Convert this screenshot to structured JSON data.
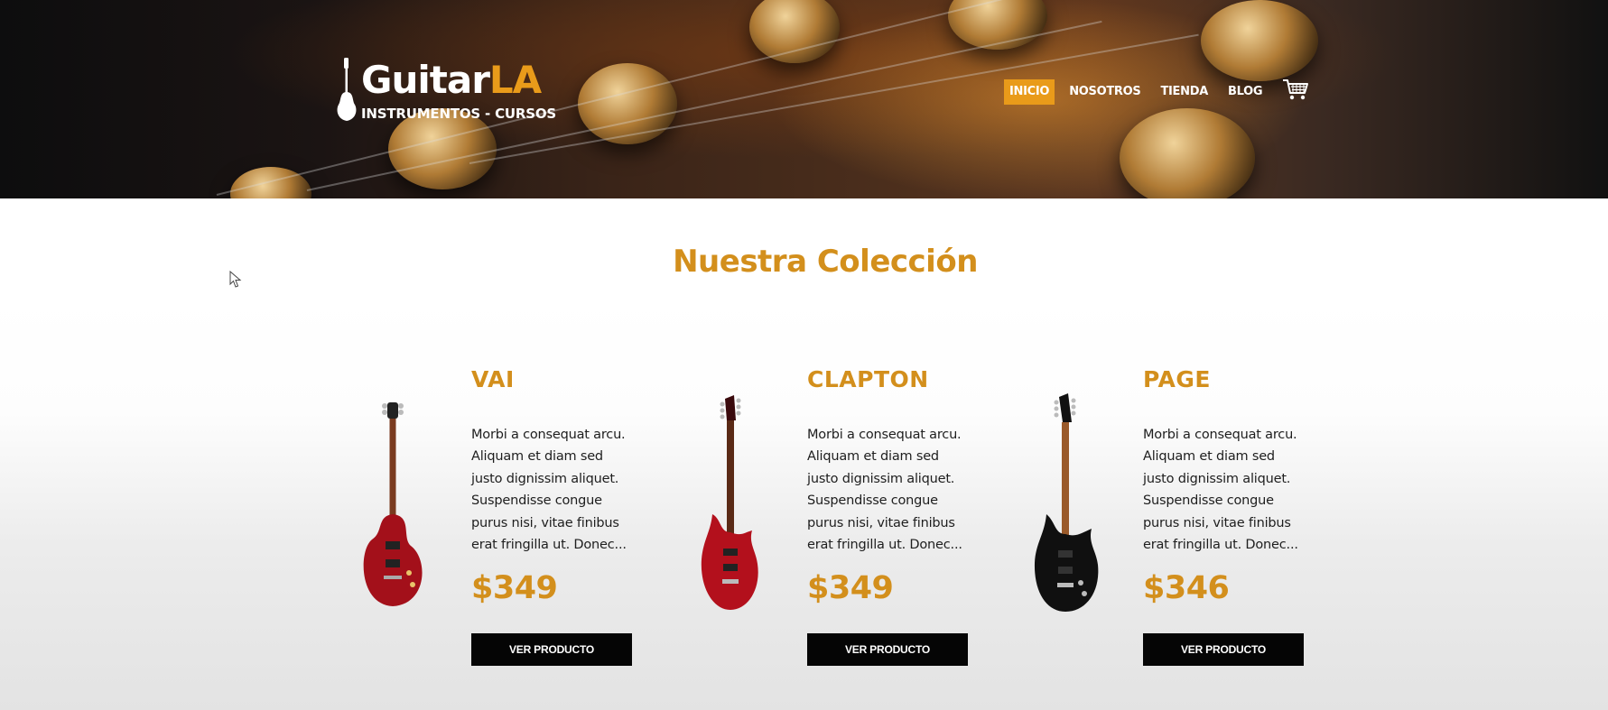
{
  "brand": {
    "name_main": "Guitar",
    "name_accent": "LA",
    "tagline": "INSTRUMENTOS - CURSOS"
  },
  "nav": {
    "items": [
      {
        "label": "INICIO",
        "active": true
      },
      {
        "label": "NOSOTROS",
        "active": false
      },
      {
        "label": "TIENDA",
        "active": false
      },
      {
        "label": "BLOG",
        "active": false
      }
    ],
    "cart_icon": "cart-icon"
  },
  "collection": {
    "title": "Nuestra Colección",
    "products": [
      {
        "name": "VAI",
        "description": "Morbi a consequat arcu. Aliquam et diam sed justo dignissim aliquet. Suspendisse congue purus nisi, vitae finibus erat fringilla ut. Donec...",
        "price": "$349",
        "button": "VER PRODUCTO",
        "guitar_color": "#a3101a",
        "guitar_style": "les-paul"
      },
      {
        "name": "CLAPTON",
        "description": "Morbi a consequat arcu. Aliquam et diam sed justo dignissim aliquet. Suspendisse congue purus nisi, vitae finibus erat fringilla ut. Donec...",
        "price": "$349",
        "button": "VER PRODUCTO",
        "guitar_color": "#b3101c",
        "guitar_style": "superstrat"
      },
      {
        "name": "PAGE",
        "description": "Morbi a consequat arcu. Aliquam et diam sed justo dignissim aliquet. Suspendisse congue purus nisi, vitae finibus erat fringilla ut. Donec...",
        "price": "$346",
        "button": "VER PRODUCTO",
        "guitar_color": "#101010",
        "guitar_style": "superstrat"
      }
    ]
  },
  "colors": {
    "accent": "#e99b1a",
    "title": "#d38f1c",
    "button_bg": "#050505"
  }
}
